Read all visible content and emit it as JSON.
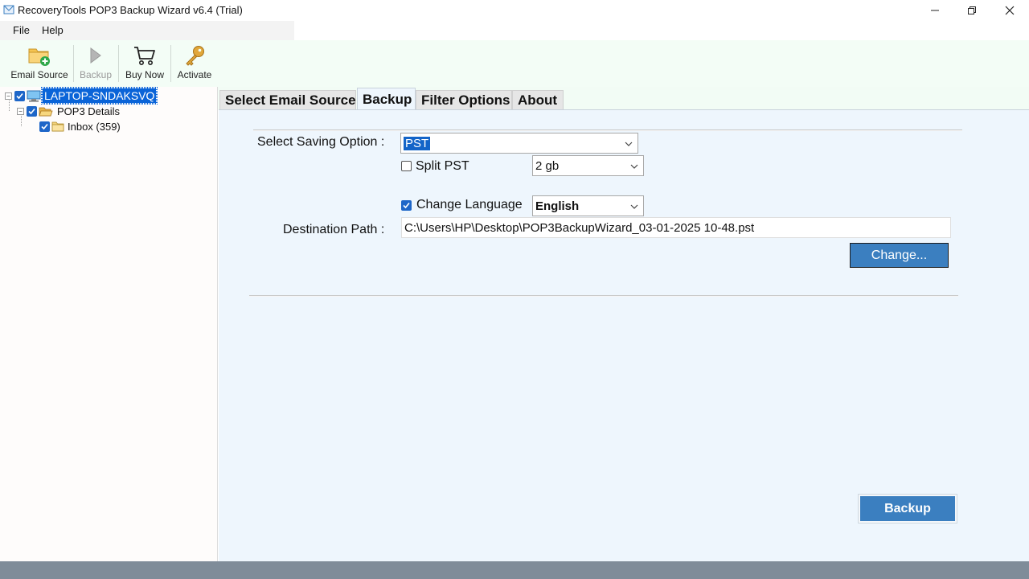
{
  "window": {
    "title": "RecoveryTools POP3 Backup Wizard v6.4 (Trial)",
    "icons": [
      "app-icon",
      "minimize-icon",
      "restore-icon",
      "close-icon"
    ]
  },
  "menu": {
    "file": "File",
    "help": "Help"
  },
  "toolbar": {
    "email_source": "Email Source",
    "backup": "Backup",
    "buy_now": "Buy Now",
    "activate": "Activate",
    "icons": [
      "folder-add-icon",
      "play-icon",
      "cart-icon",
      "key-icon"
    ]
  },
  "tree": {
    "root": "LAPTOP-SNDAKSVQ",
    "child": "POP3 Details",
    "grandchild": "Inbox (359)"
  },
  "tabs": {
    "select_source": "Select Email Source",
    "backup": "Backup",
    "filter": "Filter Options",
    "about": "About",
    "active": "Backup"
  },
  "form": {
    "saving_label": "Select Saving Option :",
    "saving_value": "PST",
    "split_label": "Split PST",
    "split_checked": false,
    "split_size": "2 gb",
    "language_label": "Change Language",
    "language_checked": true,
    "language_value": "English",
    "destination_label": "Destination Path :",
    "destination_value": "C:\\Users\\HP\\Desktop\\POP3BackupWizard_03-01-2025 10-48.pst",
    "change_button": "Change...",
    "backup_button": "Backup"
  },
  "colors": {
    "accent": "#3b7fc0",
    "selection": "#0a64d8",
    "toolbar_bg": "#f3fdf6",
    "content_bg": "#eef6fd",
    "status_bar": "#7f8c99"
  }
}
